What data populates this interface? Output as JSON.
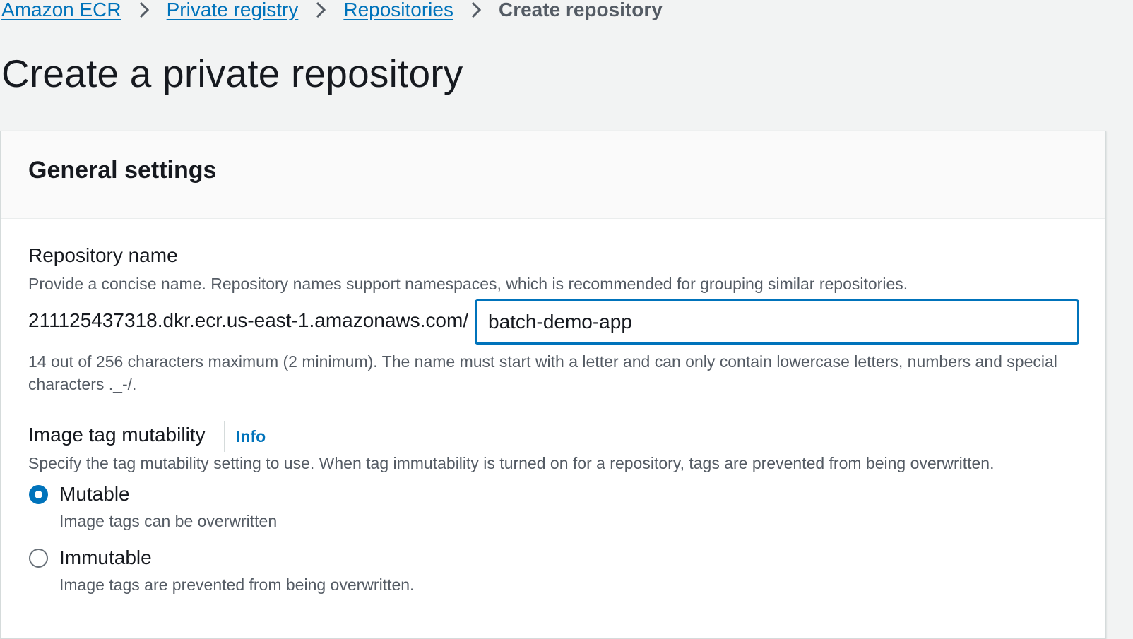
{
  "breadcrumbs": {
    "items": [
      {
        "label": "Amazon ECR"
      },
      {
        "label": "Private registry"
      },
      {
        "label": "Repositories"
      },
      {
        "label": "Create repository"
      }
    ]
  },
  "page": {
    "title": "Create a private repository"
  },
  "general_settings": {
    "title": "General settings",
    "repository_name": {
      "label": "Repository name",
      "description": "Provide a concise name. Repository names support namespaces, which is recommended for grouping similar repositories.",
      "prefix": "211125437318.dkr.ecr.us-east-1.amazonaws.com/",
      "value": "batch-demo-app",
      "constraint": "14 out of 256 characters maximum (2 minimum). The name must start with a letter and can only contain lowercase letters, numbers and special characters ._-/."
    },
    "tag_mutability": {
      "label": "Image tag mutability",
      "info_label": "Info",
      "description": "Specify the tag mutability setting to use. When tag immutability is turned on for a repository, tags are prevented from being overwritten.",
      "options": [
        {
          "label": "Mutable",
          "description": "Image tags can be overwritten",
          "selected": true
        },
        {
          "label": "Immutable",
          "description": "Image tags are prevented from being overwritten.",
          "selected": false
        }
      ]
    }
  },
  "colors": {
    "link": "#0073bb",
    "text": "#16191f",
    "secondary_text": "#545b64",
    "background": "#f2f3f3"
  }
}
